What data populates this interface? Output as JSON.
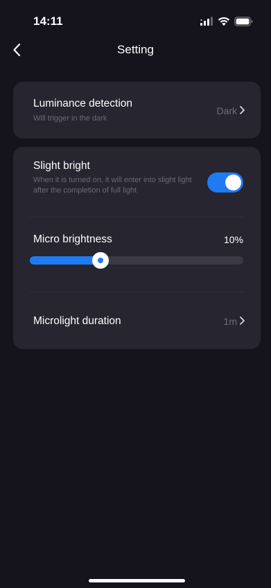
{
  "status_bar": {
    "time": "14:11",
    "icons": [
      "signal-icon",
      "wifi-icon",
      "battery-icon"
    ]
  },
  "header": {
    "title": "Setting",
    "back_icon": "chevron-left-icon"
  },
  "luminance": {
    "title": "Luminance detection",
    "subtitle": "Will trigger in the dark",
    "value": "Dark"
  },
  "slight_bright": {
    "title": "Slight bright",
    "description": "When it is turned on, it will enter into slight light after the completion of full light",
    "enabled": true
  },
  "micro_brightness": {
    "title": "Micro brightness",
    "value_label": "10%",
    "slider_fraction": 0.33
  },
  "microlight_duration": {
    "title": "Microlight duration",
    "value": "1m"
  },
  "colors": {
    "accent": "#1f7bf2",
    "background": "#15141d",
    "card": "#262530",
    "muted_text": "#6b6a76"
  }
}
